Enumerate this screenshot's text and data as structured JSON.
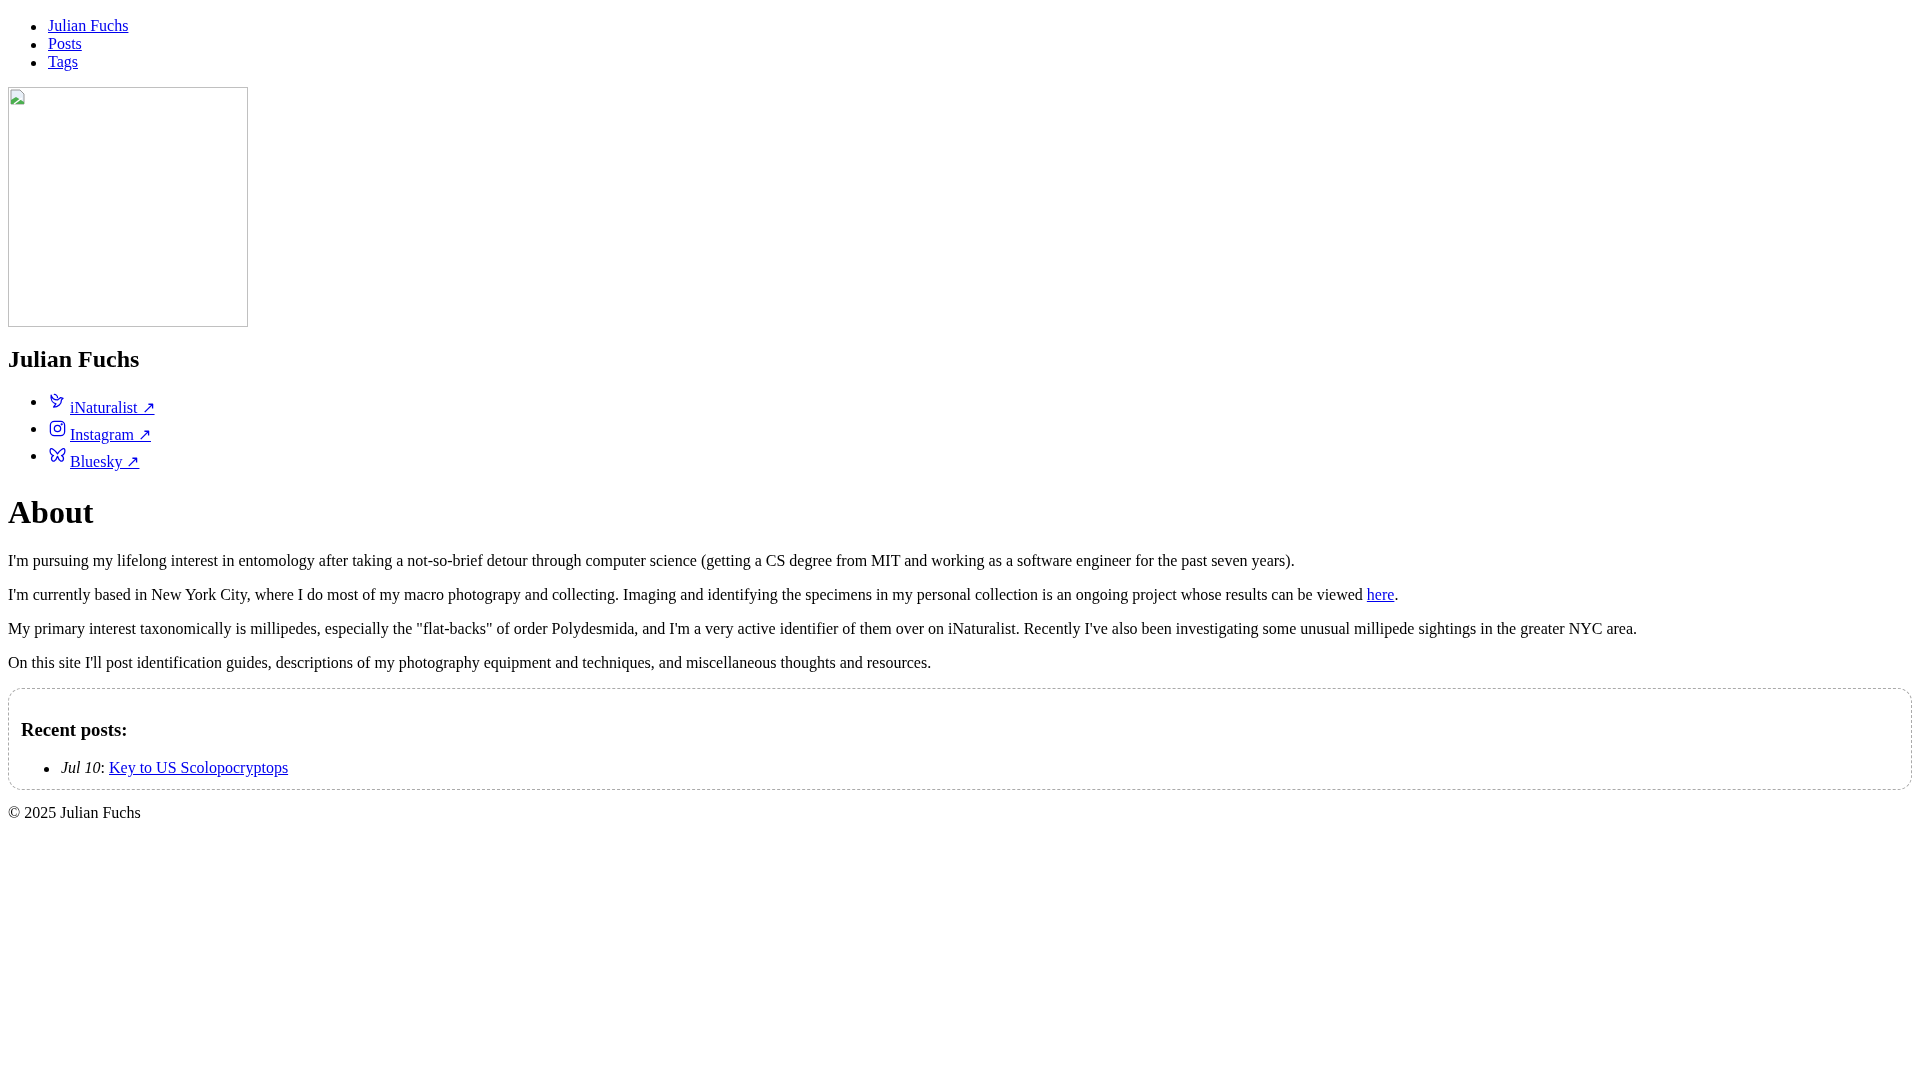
{
  "nav": [
    {
      "label": "Julian Fuchs"
    },
    {
      "label": "Posts"
    },
    {
      "label": "Tags"
    }
  ],
  "profile_image": {
    "kind": "broken-image"
  },
  "name": "Julian Fuchs",
  "social_links": [
    {
      "label": "iNaturalist ↗"
    },
    {
      "label": "Instagram ↗"
    },
    {
      "label": "Bluesky ↗"
    }
  ],
  "about": {
    "heading": "About",
    "paragraphs": [
      {
        "text": "I'm pursuing my lifelong interest in entomology after taking a not-so-brief detour through computer science (getting a CS degree from MIT and working as a software engineer for the past seven years)."
      },
      {
        "text": "I'm currently based in New York City, where I do most of my macro photograpy and collecting. Imaging and identifying the specimens in my personal collection is an ongoing project whose results can be viewed ",
        "link": "here",
        "after": "."
      },
      {
        "text": "My primary interest taxonomically is millipedes, especially the \"flat-backs\" of order Polydesmida, and I'm a very active identifier of them over on iNaturalist. Recently I've also been investigating some unusual millipede sightings in the greater NYC area."
      },
      {
        "text": "On this site I'll post identification guides, descriptions of my photography equipment and techniques, and miscellaneous thoughts and resources."
      }
    ]
  },
  "recent_posts": {
    "heading": "Recent posts:",
    "items": [
      {
        "date": "*Jul 10*:",
        "title": "Key to US Scolopocryptops"
      }
    ]
  },
  "footer": "© 2025 Julian Fuchs"
}
